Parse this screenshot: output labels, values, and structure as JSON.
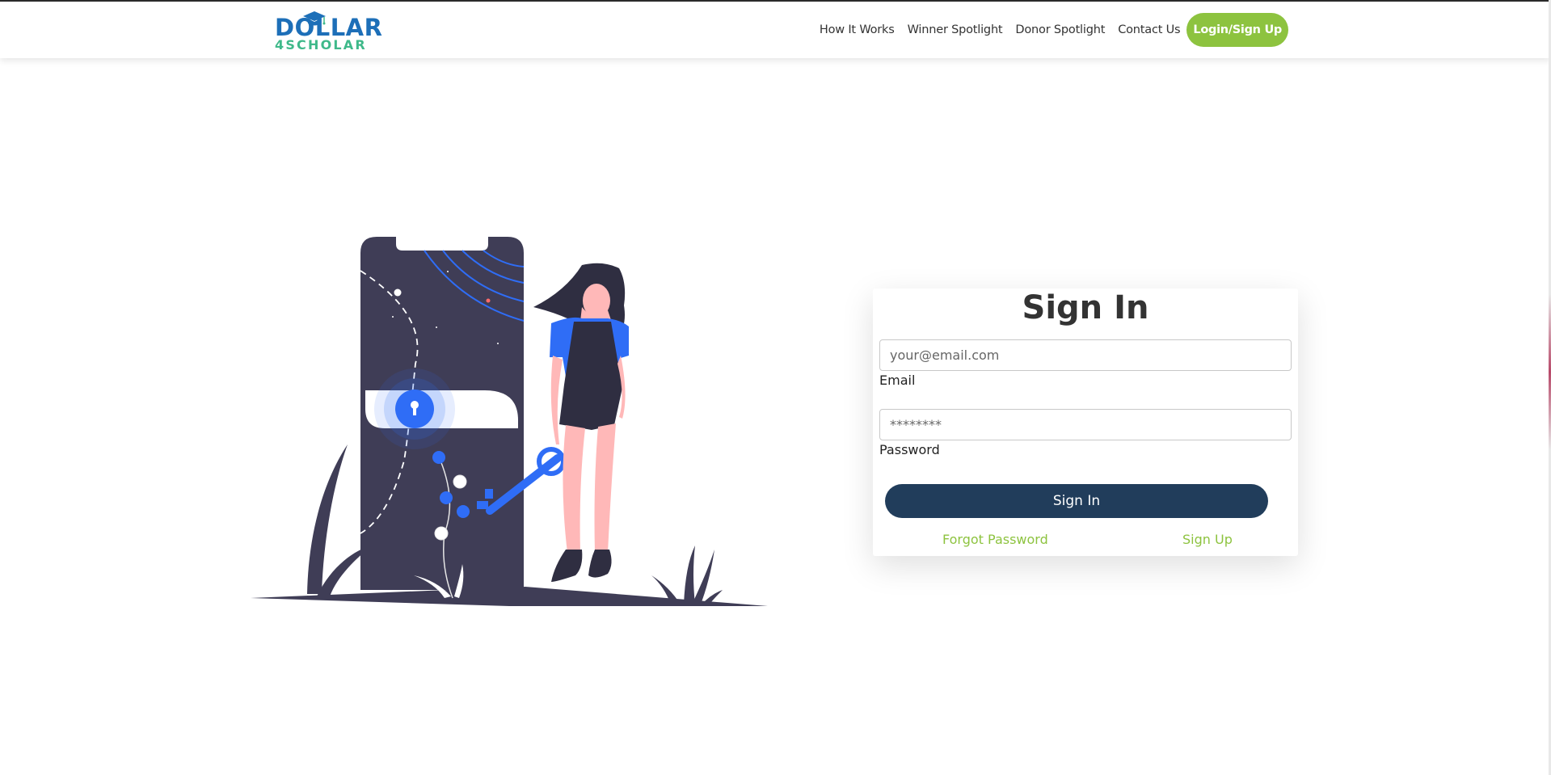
{
  "brand": {
    "logo_line1": "DOLLAR",
    "logo_line2": "4SCHOLAR"
  },
  "nav": {
    "items": [
      {
        "label": "How It Works"
      },
      {
        "label": "Winner Spotlight"
      },
      {
        "label": "Donor Spotlight"
      },
      {
        "label": "Contact Us"
      }
    ],
    "cta_label": "Login/Sign Up"
  },
  "signin": {
    "title": "Sign In",
    "email_placeholder": "your@email.com",
    "email_label": "Email",
    "password_placeholder": "********",
    "password_label": "Password",
    "submit_label": "Sign In",
    "forgot_label": "Forgot Password",
    "signup_label": "Sign Up"
  },
  "colors": {
    "accent_green": "#8dc33f",
    "button_navy": "#213d5b",
    "logo_blue": "#1d6fb8",
    "logo_teal": "#3fb98a",
    "illustration_dark": "#3f3d56",
    "illustration_blue": "#2f6df6"
  },
  "icons": {
    "logo_cap": "graduation-cap-icon",
    "lock": "keyhole-lock-icon",
    "key": "key-icon"
  }
}
